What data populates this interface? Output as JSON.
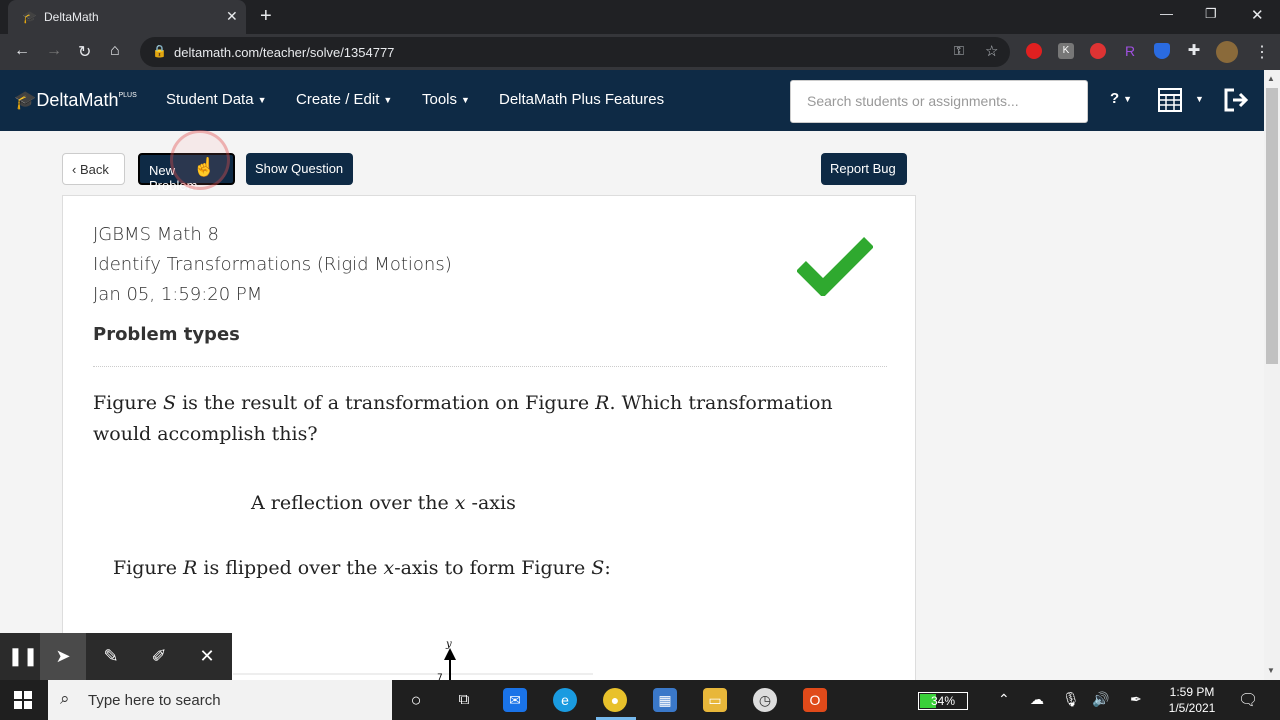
{
  "browser": {
    "tab_title": "DeltaMath",
    "url": "deltamath.com/teacher/solve/1354777"
  },
  "nav": {
    "logo": "DeltaMath",
    "logo_sup": "PLUS",
    "student_data": "Student Data",
    "create_edit": "Create / Edit",
    "tools": "Tools",
    "plus_features": "DeltaMath Plus Features",
    "search_placeholder": "Search students or assignments...",
    "help": "?"
  },
  "actions": {
    "back": "Back",
    "new_problem": "New Problem",
    "show_question": "Show Question",
    "report_bug": "Report Bug"
  },
  "problem": {
    "class_name": "JGBMS Math 8",
    "assignment": "Identify Transformations (Rigid Motions)",
    "timestamp": "Jan 05, 1:59:20 PM",
    "problem_types": "Problem types",
    "q_part1": "Figure ",
    "q_var1": "S",
    "q_part2": " is the result of a transformation on Figure ",
    "q_var2": "R",
    "q_part3": ". Which transformation would accomplish this?",
    "answer_part1": "A reflection over the ",
    "answer_var": "x",
    "answer_part2": " -axis",
    "ex_part1": "Figure ",
    "ex_var1": "R",
    "ex_part2": " is flipped over the ",
    "ex_var2": "x",
    "ex_part3": "-axis to form Figure ",
    "ex_var3": "S",
    "ex_part4": ":",
    "graph_y_label": "y",
    "graph_tick": "7",
    "status": "correct"
  },
  "taskbar": {
    "search_text": "Type here to search",
    "battery": "34%",
    "battery_level": 0.34,
    "time": "1:59 PM",
    "date": "1/5/2021"
  },
  "colors": {
    "nav_bg": "#0e2a45",
    "check_green": "#2fa92f"
  }
}
